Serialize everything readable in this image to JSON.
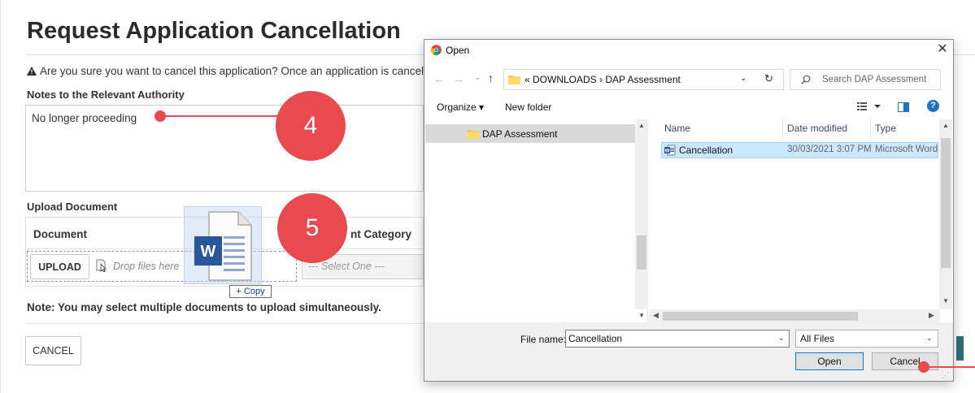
{
  "page": {
    "title": "Request Application Cancellation",
    "warning": "Are you sure you want to cancel this application? Once an application is cancell",
    "notes_heading": "Notes to the Relevant Authority",
    "notes_value": "No longer proceeding",
    "upload_heading": "Upload Document",
    "col_document": "Document",
    "col_category": "nt Category",
    "upload_button": "UPLOAD",
    "drop_placeholder": "Drop files here",
    "select_placeholder": "--- Select One ---",
    "multi_note": "Note: You may select multiple documents to upload simultaneously.",
    "cancel_button": "CANCEL"
  },
  "annotations": {
    "step4": "4",
    "step5": "5",
    "color": "#e84a4f"
  },
  "drag": {
    "copy_label": "+ Copy",
    "icon": "word-document-icon"
  },
  "dialog": {
    "title": "Open",
    "address": "« DOWNLOADS  ›  DAP Assessment",
    "search_placeholder": "Search DAP Assessment",
    "organize_label": "Organize ▾",
    "new_folder_label": "New folder",
    "nav_items": [
      {
        "label": "DAP Assessment",
        "icon": "folder-icon"
      }
    ],
    "columns": [
      "Name",
      "Date modified",
      "Type"
    ],
    "files": [
      {
        "name": "Cancellation",
        "date": "30/03/2021 3:07 PM",
        "type": "Microsoft Word",
        "icon": "word-file-icon"
      }
    ],
    "file_name_label": "File name:",
    "file_name_value": "Cancellation",
    "file_type_value": "All Files",
    "open_button": "Open",
    "cancel_button": "Cancel"
  }
}
